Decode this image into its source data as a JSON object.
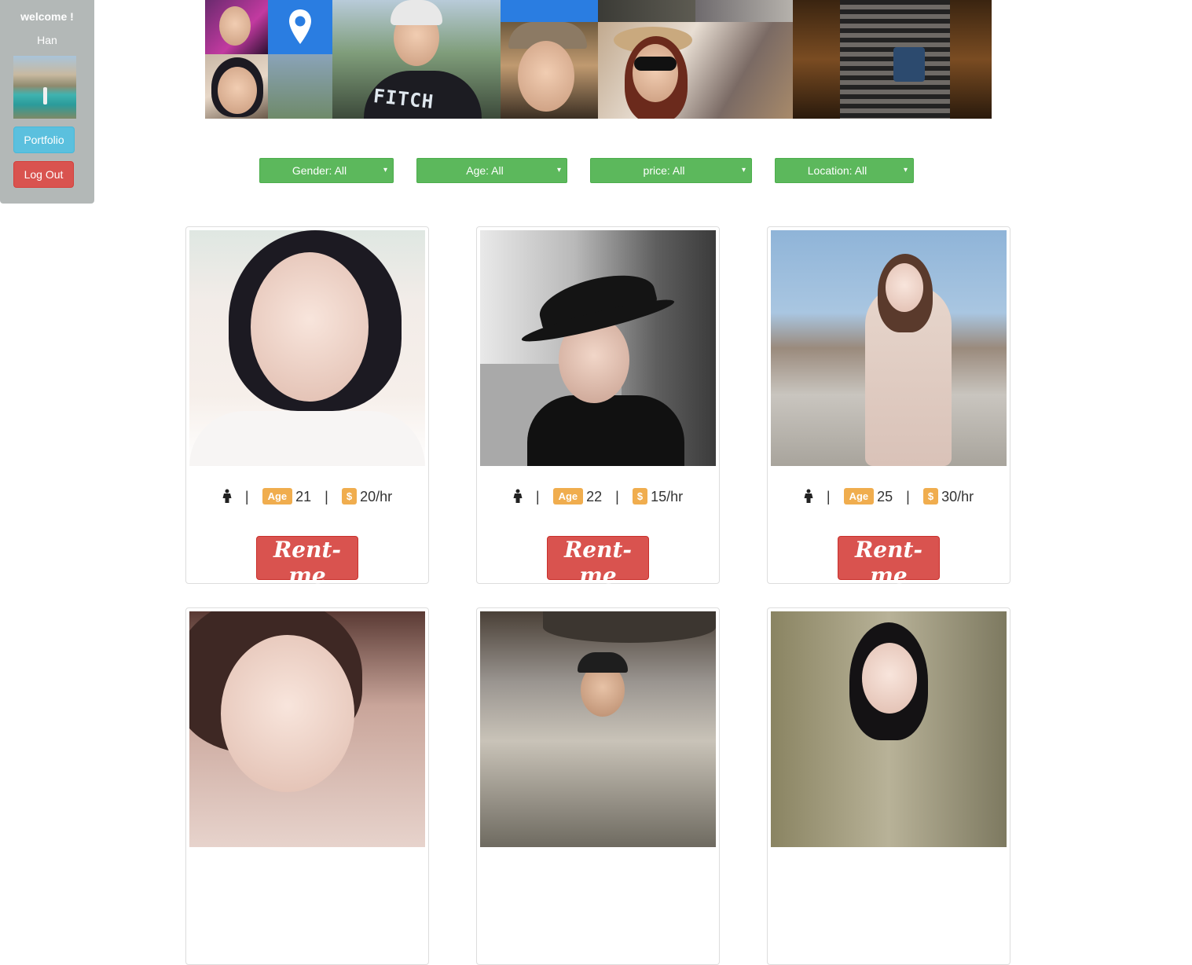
{
  "sidebar": {
    "welcome": "welcome !",
    "username": "Han",
    "portfolio_label": "Portfolio",
    "logout_label": "Log Out"
  },
  "banner": {
    "fitch_text": "FITCH"
  },
  "filters": {
    "gender": "Gender: All",
    "age": "Age: All",
    "price": "price: All",
    "location": "Location: All",
    "caret": "▾"
  },
  "cards": [
    {
      "age": "21",
      "price": "20/hr",
      "age_badge": "Age",
      "dollar_badge": "$",
      "sep": "|",
      "rent_label": "Rent-me"
    },
    {
      "age": "22",
      "price": "15/hr",
      "age_badge": "Age",
      "dollar_badge": "$",
      "sep": "|",
      "rent_label": "Rent-me"
    },
    {
      "age": "25",
      "price": "30/hr",
      "age_badge": "Age",
      "dollar_badge": "$",
      "sep": "|",
      "rent_label": "Rent-me"
    }
  ],
  "colors": {
    "sidebar_bg": "#b3b8b7",
    "filter_green": "#5cb85c",
    "badge_orange": "#f0ad4e",
    "rent_red": "#d9534f",
    "portfolio_blue": "#5bc0de",
    "banner_blue": "#2a7de1"
  },
  "icons": {
    "location": "location-pin-icon",
    "gender": "person-icon"
  }
}
